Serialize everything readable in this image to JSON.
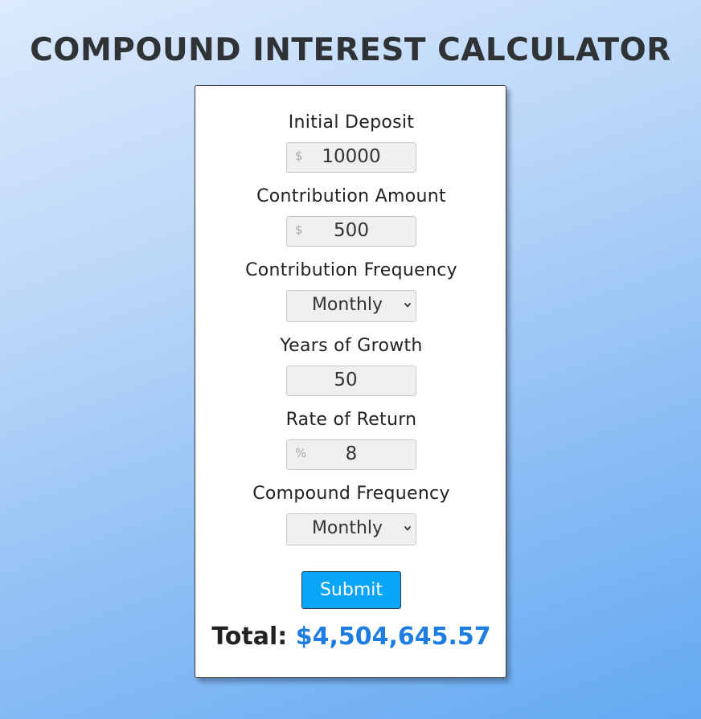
{
  "page": {
    "title": "COMPOUND INTEREST CALCULATOR"
  },
  "form": {
    "initial_deposit": {
      "label": "Initial Deposit",
      "prefix": "$",
      "value": "10000"
    },
    "contribution_amount": {
      "label": "Contribution Amount",
      "prefix": "$",
      "value": "500"
    },
    "contribution_frequency": {
      "label": "Contribution Frequency",
      "selected": "Monthly",
      "icon": "chevron-down-icon"
    },
    "years_of_growth": {
      "label": "Years of Growth",
      "value": "50"
    },
    "rate_of_return": {
      "label": "Rate of Return",
      "prefix": "%",
      "value": "8"
    },
    "compound_frequency": {
      "label": "Compound Frequency",
      "selected": "Monthly",
      "icon": "chevron-down-icon"
    },
    "submit_label": "Submit"
  },
  "result": {
    "label": "Total:",
    "value": "$4,504,645.57"
  },
  "colors": {
    "accent": "#1d7de1",
    "button": "#0aa5f6",
    "title": "#2f3336",
    "background_start": "#dceafc",
    "background_end": "#63a9f2"
  }
}
